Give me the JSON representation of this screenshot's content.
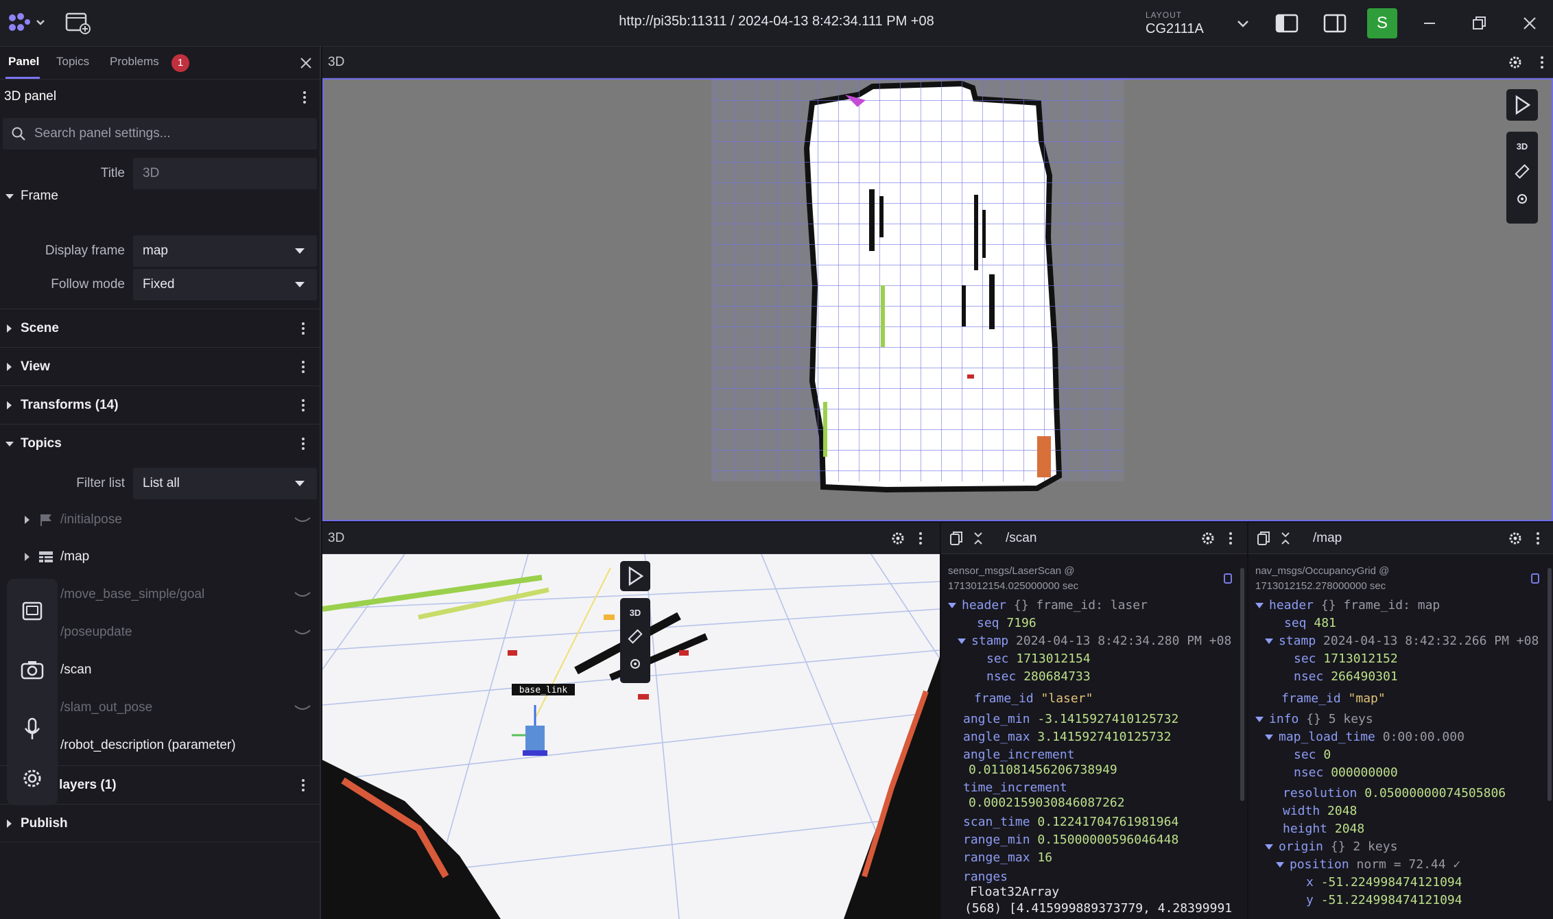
{
  "topbar": {
    "url": "http://pi35b:11311 / 2024-04-13 8:42:34.111 PM +08",
    "layout_label": "LAYOUT",
    "layout_name": "CG2111A",
    "avatar_letter": "S"
  },
  "sidebar": {
    "tabs": [
      {
        "label": "Panel"
      },
      {
        "label": "Topics"
      },
      {
        "label": "Problems"
      }
    ],
    "problems_count": "1",
    "section_title": "3D panel",
    "search_placeholder": "Search panel settings...",
    "title_label": "Title",
    "title_value": "3D",
    "frame_group": "Frame",
    "display_frame_label": "Display frame",
    "display_frame_value": "map",
    "follow_mode_label": "Follow mode",
    "follow_mode_value": "Fixed",
    "groups": {
      "scene": "Scene",
      "view": "View",
      "transforms": "Transforms (14)",
      "topics": "Topics",
      "custom_layers": "m layers (1)",
      "publish": "Publish"
    },
    "filter_label": "Filter list",
    "filter_value": "List all",
    "topics": [
      {
        "name": "/initialpose"
      },
      {
        "name": "/map"
      },
      {
        "name": "/move_base_simple/goal"
      },
      {
        "name": "/poseupdate"
      },
      {
        "name": "/scan"
      },
      {
        "name": "/slam_out_pose"
      },
      {
        "name": "/robot_description (parameter)"
      }
    ]
  },
  "panels": {
    "top3d": {
      "title": "3D",
      "mode": "3D"
    },
    "bottom3d": {
      "title": "3D",
      "mode": "3D",
      "tf_label": "base_link"
    },
    "scan": {
      "topic": "/scan"
    },
    "map": {
      "topic": "/map"
    }
  },
  "scan_msg": {
    "type": "sensor_msgs/LaserScan @",
    "receive_time": "1713012154.025000000 sec",
    "header_key": "header",
    "header_summary": "{} frame_id: laser",
    "seq_key": "seq",
    "seq_val": "7196",
    "stamp_key": "stamp",
    "stamp_val": "2024-04-13 8:42:34.280 PM +08",
    "sec_key": "sec",
    "sec_val": "1713012154",
    "nsec_key": "nsec",
    "nsec_val": "280684733",
    "frame_id_key": "frame_id",
    "frame_id_val": "\"laser\"",
    "angle_min_key": "angle_min",
    "angle_min_val": "-3.1415927410125732",
    "angle_max_key": "angle_max",
    "angle_max_val": "3.1415927410125732",
    "angle_increment_key": "angle_increment",
    "angle_increment_val": "0.011081456206738949",
    "time_increment_key": "time_increment",
    "time_increment_val": "0.0002159030846087262",
    "scan_time_key": "scan_time",
    "scan_time_val": "0.12241704761981964",
    "range_min_key": "range_min",
    "range_min_val": "0.15000000596046448",
    "range_max_key": "range_max",
    "range_max_val": "16",
    "ranges_key": "ranges",
    "ranges_type": "Float32Array",
    "ranges_preview": "(568) [4.415999889373779, 4.28399991"
  },
  "map_msg": {
    "type": "nav_msgs/OccupancyGrid @",
    "receive_time": "1713012152.278000000 sec",
    "header_key": "header",
    "header_summary": "{} frame_id: map",
    "seq_key": "seq",
    "seq_val": "481",
    "stamp_key": "stamp",
    "stamp_val": "2024-04-13 8:42:32.266 PM +08",
    "sec_key": "sec",
    "sec_val": "1713012152",
    "nsec_key": "nsec",
    "nsec_val": "266490301",
    "frame_id_key": "frame_id",
    "frame_id_val": "\"map\"",
    "info_key": "info",
    "info_summary": "{} 5 keys",
    "map_load_time_key": "map_load_time",
    "map_load_time_val": "0:00:00.000",
    "mlt_sec_key": "sec",
    "mlt_sec_val": "0",
    "mlt_nsec_key": "nsec",
    "mlt_nsec_val": "000000000",
    "resolution_key": "resolution",
    "resolution_val": "0.05000000074505806",
    "width_key": "width",
    "width_val": "2048",
    "height_key": "height",
    "height_val": "2048",
    "origin_key": "origin",
    "origin_summary": "{} 2 keys",
    "position_key": "position",
    "position_summary": "norm = 72.44 ✓",
    "x_key": "x",
    "x_val": "-51.224998474121094",
    "y_key": "y",
    "y_val": "-51.224998474121094"
  },
  "colors": {
    "accent": "#7b75f2",
    "badge": "#c0303e",
    "avatar": "#2f9e3a",
    "key": "#8e9cf5",
    "value": "#bde08a",
    "string": "#e2c27a"
  }
}
